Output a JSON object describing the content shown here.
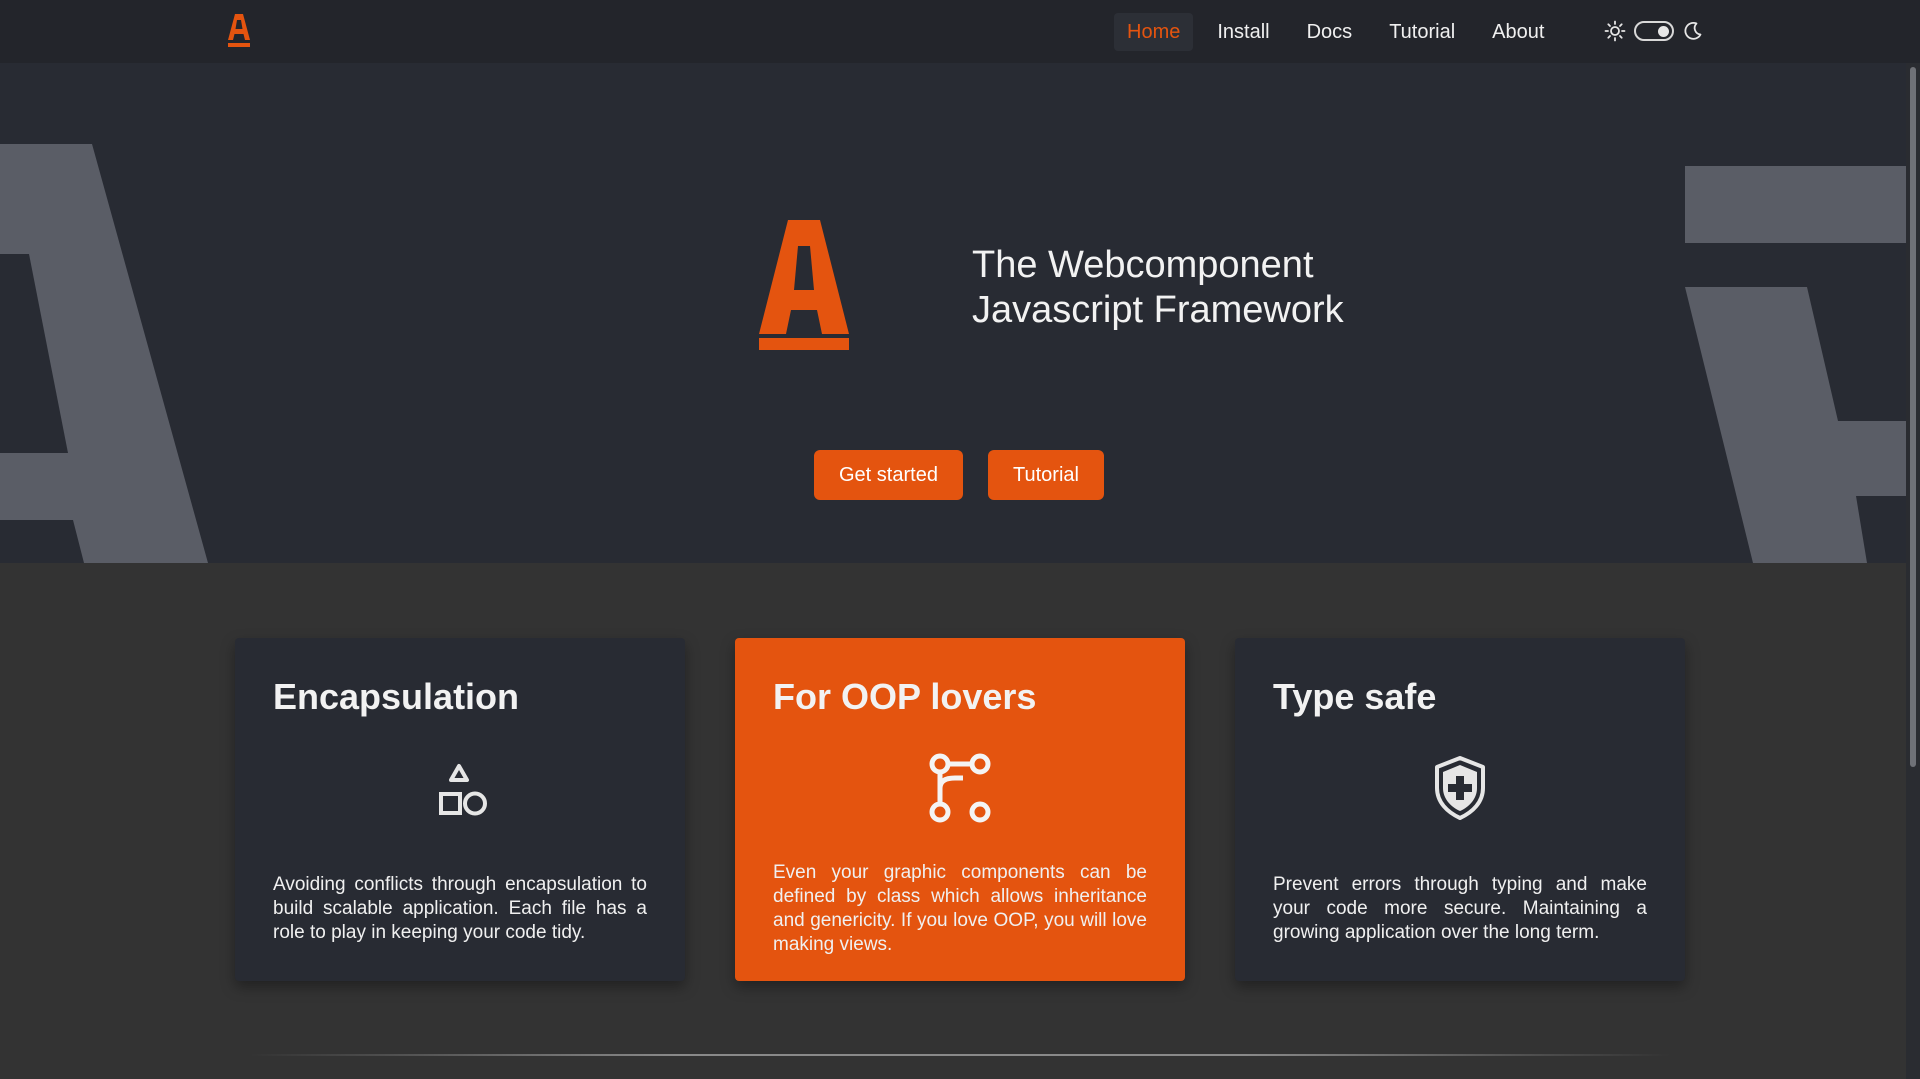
{
  "nav": {
    "items": [
      {
        "label": "Home",
        "active": true
      },
      {
        "label": "Install"
      },
      {
        "label": "Docs"
      },
      {
        "label": "Tutorial"
      },
      {
        "label": "About"
      }
    ],
    "theme": {
      "light_icon": "sun-icon",
      "dark_icon": "moon-icon",
      "dark_mode_on": true
    }
  },
  "hero": {
    "title_line1": "The Webcomponent",
    "title_line2": "Javascript Framework",
    "primary_button": "Get started",
    "secondary_button": "Tutorial"
  },
  "features": [
    {
      "title": "Encapsulation",
      "icon": "shapes-icon",
      "text": "Avoiding conflicts through encapsulation to build scalable application. Each file has a role to play in keeping your code tidy."
    },
    {
      "title": "For OOP lovers",
      "icon": "git-branch-icon",
      "text": "Even your graphic components can be defined by class which allows inheritance and genericity. If you love OOP, you will love making views."
    },
    {
      "title": "Type safe",
      "icon": "shield-plus-icon",
      "text": "Prevent errors through typing and make your code more secure. Maintaining a growing application over the long term."
    }
  ],
  "colors": {
    "accent": "#e4540f",
    "navbar": "#23252b",
    "hero": "#282b33",
    "page": "#333333"
  }
}
